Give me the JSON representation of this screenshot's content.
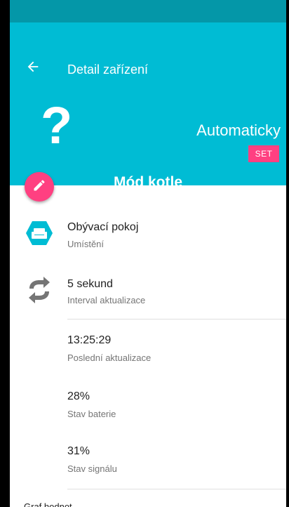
{
  "header": {
    "back_icon": "arrow-left-icon",
    "title": "Detail zařízení",
    "status_symbol": "?",
    "mode": "Automaticky",
    "set_label": "SET",
    "device_name": "Mód  kotle",
    "edit_icon": "pencil-icon"
  },
  "colors": {
    "primary": "#00bcd4",
    "primary_dark": "#0497a8",
    "accent": "#ff4081"
  },
  "details": [
    {
      "icon": "sofa-icon",
      "value": "Obývací pokoj",
      "label": "Umístění"
    },
    {
      "icon": "refresh-icon",
      "value": "5 sekund",
      "label": "Interval aktualizace"
    },
    {
      "icon": "",
      "value": "13:25:29",
      "label": "Poslední aktualizace"
    },
    {
      "icon": "",
      "value": "28%",
      "label": "Stav baterie"
    },
    {
      "icon": "",
      "value": "31%",
      "label": "Stav signálu"
    }
  ],
  "footer": {
    "partial_label": "Graf hodnot"
  }
}
